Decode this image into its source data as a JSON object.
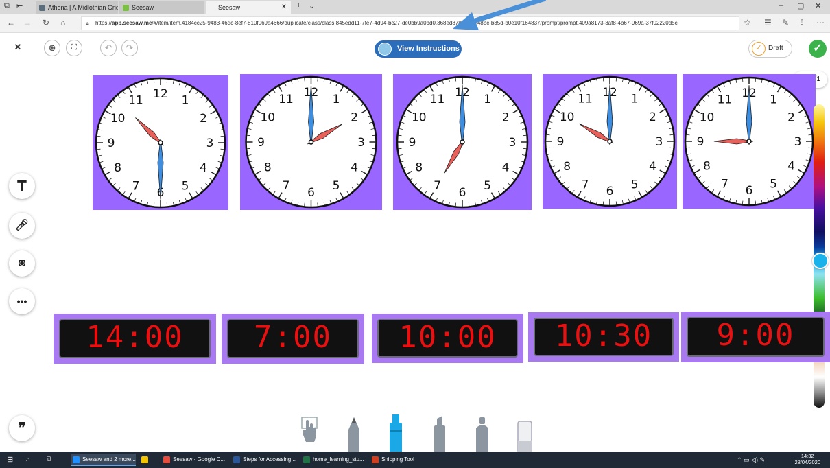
{
  "browser": {
    "tabs": [
      {
        "label": "Athena | A Midlothian Grid",
        "color": "#5b6c7a"
      },
      {
        "label": "Seesaw",
        "color": "#7bc043"
      },
      {
        "label": "Seesaw",
        "active": true
      }
    ],
    "url": "https://app.seesaw.me/#/item/item.4184cc25-9483-46dc-8ef7-810f069a4666/duplicate/class/class.845edd11-7fe7-4d94-bc27-de0bb9a0bd0…368ed878-5236-48bc-b35d-b0e10f164837/prompt/prompt.409a8173-3af8-4b67-969a-37f02220d5c",
    "url_prefix": "https://",
    "url_host": "app.seesaw.me",
    "url_rest": "/#/item/item.4184cc25-9483-46dc-8ef7-810f069a4666/duplicate/class/class.845edd11-7fe7-4d94-bc27-de0bb9a0bd0",
    "url_tail": ".368ed878-5236-48bc-b35d-b0e10f164837/prompt/prompt.409a8173-3af8-4b67-969a-37f02220d5c"
  },
  "toolbar": {
    "view_instructions": "View Instructions",
    "draft": "Draft"
  },
  "page_indicator": "1/1",
  "analog_clocks": [
    {
      "hour": 10,
      "minute": 30
    },
    {
      "hour": 2,
      "minute": 0
    },
    {
      "hour": 7,
      "minute": 0
    },
    {
      "hour": 10,
      "minute": 0
    },
    {
      "hour": 9,
      "minute": 0
    }
  ],
  "clock_numbers": [
    "12",
    "1",
    "2",
    "3",
    "4",
    "5",
    "6",
    "7",
    "8",
    "9",
    "10",
    "11"
  ],
  "digital_clocks": [
    "14:00",
    "7:00",
    "10:00",
    "10:30",
    "9:00"
  ],
  "colors": {
    "card_purple": "#9966ff",
    "digital_purple": "#a879f0",
    "digital_red": "#e81010",
    "hour_hand": "#e8605a",
    "minute_hand": "#3d8ee0",
    "instructions_blue": "#2c6dbb",
    "check_green": "#3cb34a"
  },
  "taskbar": {
    "items": [
      {
        "label": "Seesaw and 2 more...",
        "color": "#1e90ff",
        "active": true
      },
      {
        "label": "",
        "color": "#f5c400"
      },
      {
        "label": "Seesaw - Google C...",
        "color": "#e74c3c"
      },
      {
        "label": "Steps for Accessing...",
        "color": "#2b579a"
      },
      {
        "label": "home_learning_stu...",
        "color": "#217346"
      },
      {
        "label": "Snipping Tool",
        "color": "#d04020"
      }
    ],
    "time": "14:32",
    "date": "28/04/2020"
  }
}
